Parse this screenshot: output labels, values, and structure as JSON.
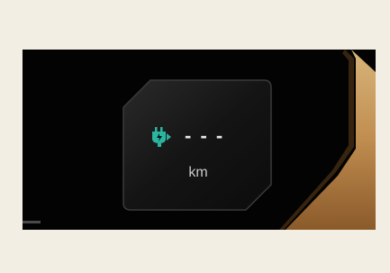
{
  "range_display": {
    "value": "- - -",
    "unit": "km",
    "icon": "ev-plug-icon"
  },
  "colors": {
    "background": "#f3eee3",
    "screen": "#030303",
    "accent": "#2bb5a0",
    "gold": "#c99a5b",
    "text": "#e8e8e8"
  }
}
